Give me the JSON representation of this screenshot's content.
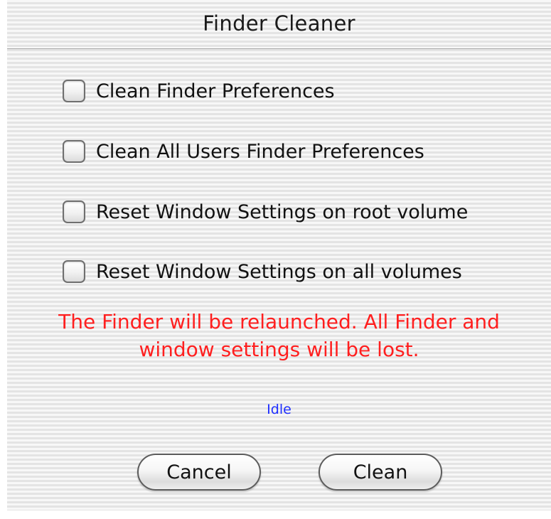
{
  "window": {
    "title": "Finder Cleaner"
  },
  "options": [
    {
      "label": "Clean Finder Preferences",
      "checked": false
    },
    {
      "label": "Clean All Users Finder Preferences",
      "checked": false
    },
    {
      "label": "Reset Window Settings on root volume",
      "checked": false
    },
    {
      "label": "Reset Window Settings on all volumes",
      "checked": false
    }
  ],
  "warning": {
    "line1": "The Finder will be relaunched.  All Finder and",
    "line2": "window settings will be lost."
  },
  "status": {
    "text": "Idle"
  },
  "buttons": {
    "cancel_label": "Cancel",
    "clean_label": "Clean"
  },
  "colors": {
    "warning": "#ff1f1f",
    "status": "#1f2fff"
  }
}
